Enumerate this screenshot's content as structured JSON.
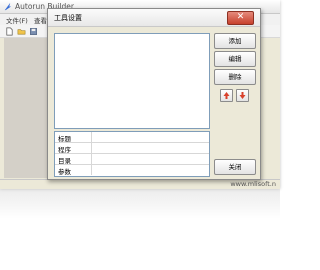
{
  "app": {
    "title": "Autorun Builder",
    "menu": [
      "文件(F)",
      "查看"
    ],
    "status_url": "www.mlisoft.n"
  },
  "toolbar": {
    "icons": [
      "new-file-icon",
      "open-folder-icon",
      "save-icon"
    ]
  },
  "dialog": {
    "title": "工具设置",
    "close_glyph": "✕",
    "buttons": {
      "add": "添加",
      "edit": "编辑",
      "delete": "删除",
      "close": "关闭"
    },
    "props": {
      "title_label": "标题",
      "program_label": "程序",
      "directory_label": "目录",
      "params_label": "参数"
    }
  },
  "colors": {
    "accent_red": "#d9412b",
    "window_bg": "#ece9d8"
  }
}
